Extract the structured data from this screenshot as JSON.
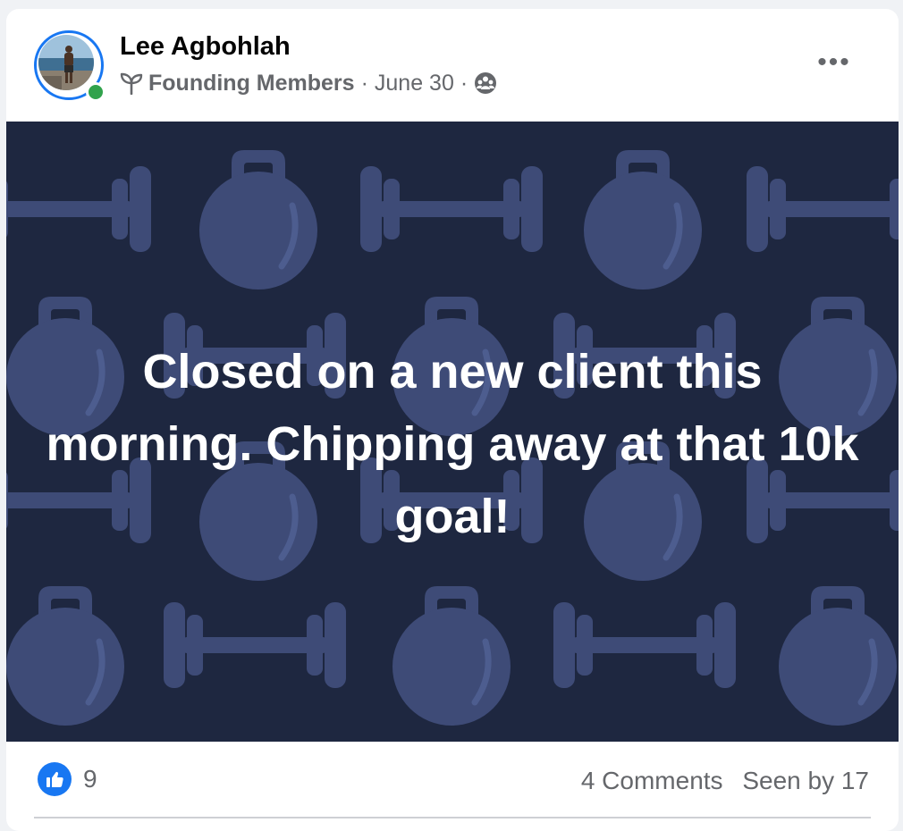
{
  "post": {
    "author": "Lee Agbohlah",
    "group": "Founding Members",
    "date": "June 30",
    "separator": "·",
    "icons": {
      "group": "sprout-icon",
      "audience": "group-audience-icon",
      "more": "more-options-icon",
      "like": "thumbs-up-icon"
    },
    "online": true,
    "more_label": "•••",
    "body_text": "Closed on a new client this morning. Chipping away at that 10k goal!",
    "background": "kettlebell-dumbbell-pattern",
    "colors": {
      "background": "#1e2740",
      "pattern": "#3e4b77",
      "text": "#ffffff",
      "accent": "#1877f2",
      "online": "#31a24c"
    }
  },
  "reactions": {
    "like_count": "9",
    "comments": "4 Comments",
    "seen": "Seen by 17"
  }
}
